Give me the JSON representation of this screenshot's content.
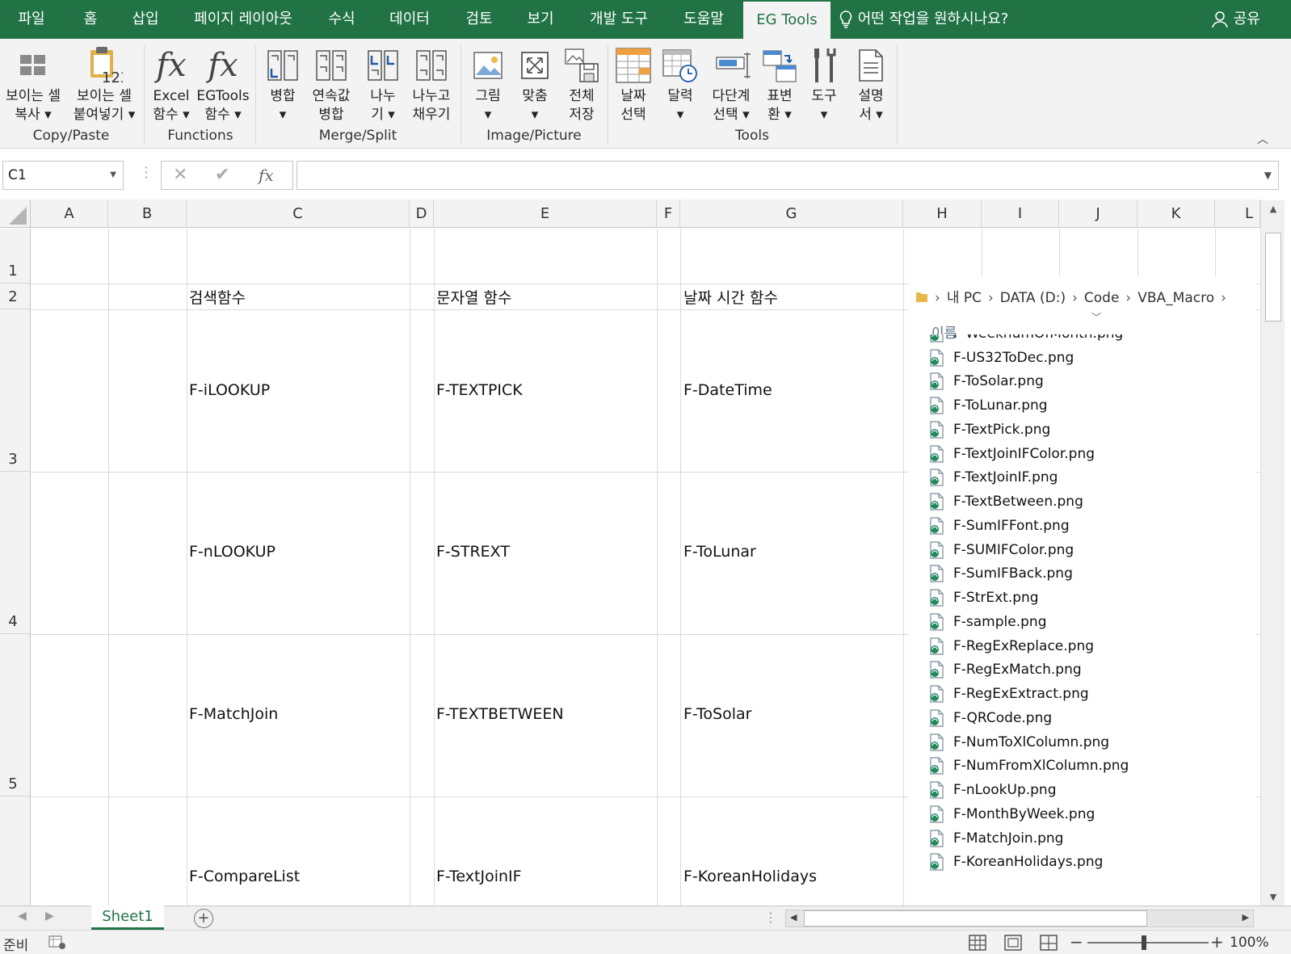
{
  "tabs": [
    "파일",
    "홈",
    "삽입",
    "페이지 레이아웃",
    "수식",
    "데이터",
    "검토",
    "보기",
    "개발 도구",
    "도움말",
    "EG Tools"
  ],
  "tell_me": "어떤 작업을 원하시나요?",
  "share": "공유",
  "ribbon": {
    "buttons": [
      {
        "l1": "보이는 셀",
        "l2": "복사 ▾",
        "icon": "copy-visible-icon"
      },
      {
        "l1": "보이는 셀",
        "l2": "붙여넣기 ▾",
        "icon": "paste-visible-icon"
      },
      {
        "l1": "Excel",
        "l2": "함수 ▾",
        "icon": "fx-icon"
      },
      {
        "l1": "EGTools",
        "l2": "함수 ▾",
        "icon": "fx-icon"
      },
      {
        "l1": "병합",
        "l2": "▾",
        "icon": "merge-icon"
      },
      {
        "l1": "연속값",
        "l2": "병합",
        "icon": "merge-continuous-icon"
      },
      {
        "l1": "나누",
        "l2": "기 ▾",
        "icon": "split-icon"
      },
      {
        "l1": "나누고",
        "l2": "채우기",
        "icon": "split-fill-icon"
      },
      {
        "l1": "그림",
        "l2": "▾",
        "icon": "picture-icon"
      },
      {
        "l1": "맞춤",
        "l2": "▾",
        "icon": "fit-icon"
      },
      {
        "l1": "전체",
        "l2": "저장",
        "icon": "save-all-icon"
      },
      {
        "l1": "날짜",
        "l2": "선택",
        "icon": "date-pick-icon"
      },
      {
        "l1": "달력",
        "l2": "▾",
        "icon": "calendar-icon"
      },
      {
        "l1": "다단계",
        "l2": "선택 ▾",
        "icon": "multi-level-icon"
      },
      {
        "l1": "표변",
        "l2": "환 ▾",
        "icon": "table-convert-icon"
      },
      {
        "l1": "도구",
        "l2": "▾",
        "icon": "tools-icon"
      },
      {
        "l1": "설명",
        "l2": "서 ▾",
        "icon": "document-icon"
      }
    ],
    "groups": [
      "Copy/Paste",
      "Functions",
      "Merge/Split",
      "Image/Picture",
      "Tools"
    ]
  },
  "formula_bar": {
    "name_box": "C1",
    "formula": ""
  },
  "columns": [
    "A",
    "B",
    "C",
    "D",
    "E",
    "F",
    "G",
    "H",
    "I",
    "J",
    "K",
    "L"
  ],
  "rows": [
    "1",
    "2",
    "3",
    "4",
    "5"
  ],
  "cells": {
    "C2": "검색함수",
    "E2": "문자열 함수",
    "G2": "날짜 시간 함수",
    "C3": "F-iLOOKUP",
    "E3": "F-TEXTPICK",
    "G3": "F-DateTime",
    "C4": "F-nLOOKUP",
    "E4": "F-STREXT",
    "G4": "F-ToLunar",
    "C5": "F-MatchJoin",
    "E5": "F-TEXTBETWEEN",
    "G5": "F-ToSolar",
    "C6": "F-CompareList",
    "E6": "F-TextJoinIF",
    "G6": "F-KoreanHolidays"
  },
  "explorer": {
    "breadcrumb": [
      "내 PC",
      "DATA (D:)",
      "Code",
      "VBA_Macro"
    ],
    "column_name": "이름",
    "files": [
      "F-WeeknumOfMonth.png",
      "F-US32ToDec.png",
      "F-ToSolar.png",
      "F-ToLunar.png",
      "F-TextPick.png",
      "F-TextJoinIFColor.png",
      "F-TextJoinIF.png",
      "F-TextBetween.png",
      "F-SumIFFont.png",
      "F-SUMIFColor.png",
      "F-SumIFBack.png",
      "F-StrExt.png",
      "F-sample.png",
      "F-RegExReplace.png",
      "F-RegExMatch.png",
      "F-RegExExtract.png",
      "F-QRCode.png",
      "F-NumToXlColumn.png",
      "F-NumFromXlColumn.png",
      "F-nLookUp.png",
      "F-MonthByWeek.png",
      "F-MatchJoin.png",
      "F-KoreanHolidays.png"
    ]
  },
  "sheet_tab": "Sheet1",
  "status": {
    "ready": "준비",
    "zoom": "100%"
  },
  "colors": {
    "accent": "#217346"
  }
}
